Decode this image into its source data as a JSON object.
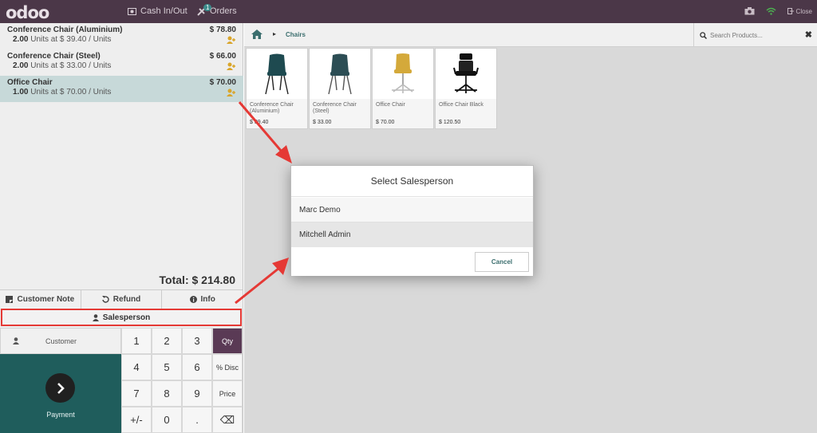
{
  "topbar": {
    "logo": "odoo",
    "cash_label": "Cash In/Out",
    "orders_label": "Orders",
    "orders_badge": "1",
    "close_label": "Close"
  },
  "order": {
    "lines": [
      {
        "name": "Conference Chair (Aluminium)",
        "price": "$ 78.80",
        "qty": "2.00",
        "detail": "Units at $ 39.40 / Units"
      },
      {
        "name": "Conference Chair (Steel)",
        "price": "$ 66.00",
        "qty": "2.00",
        "detail": "Units at $ 33.00 / Units"
      },
      {
        "name": "Office Chair",
        "price": "$ 70.00",
        "qty": "1.00",
        "detail": "Units at $ 70.00 / Units"
      }
    ],
    "total": "Total: $ 214.80"
  },
  "controls": {
    "customer_note": "Customer Note",
    "refund": "Refund",
    "info": "Info",
    "salesperson": "Salesperson"
  },
  "pad": {
    "customer": "Customer",
    "payment": "Payment",
    "keys": [
      "1",
      "2",
      "3",
      "Qty",
      "4",
      "5",
      "6",
      "% Disc",
      "7",
      "8",
      "9",
      "Price",
      "+/-",
      "0",
      ".",
      "⌫"
    ]
  },
  "products_bar": {
    "breadcrumb": "Chairs",
    "search_placeholder": "Search Products..."
  },
  "products": [
    {
      "name": "Conference Chair (Aluminium)",
      "price": "$ 39.40"
    },
    {
      "name": "Conference Chair (Steel)",
      "price": "$ 33.00"
    },
    {
      "name": "Office Chair",
      "price": "$ 70.00"
    },
    {
      "name": "Office Chair Black",
      "price": "$ 120.50"
    }
  ],
  "modal": {
    "title": "Select Salesperson",
    "options": [
      "Marc Demo",
      "Mitchell Admin"
    ],
    "cancel": "Cancel"
  },
  "colors": {
    "topbar": "#4b3748",
    "payment": "#1f5d5c",
    "active_key": "#5a3a55",
    "highlight": "#e53935"
  }
}
